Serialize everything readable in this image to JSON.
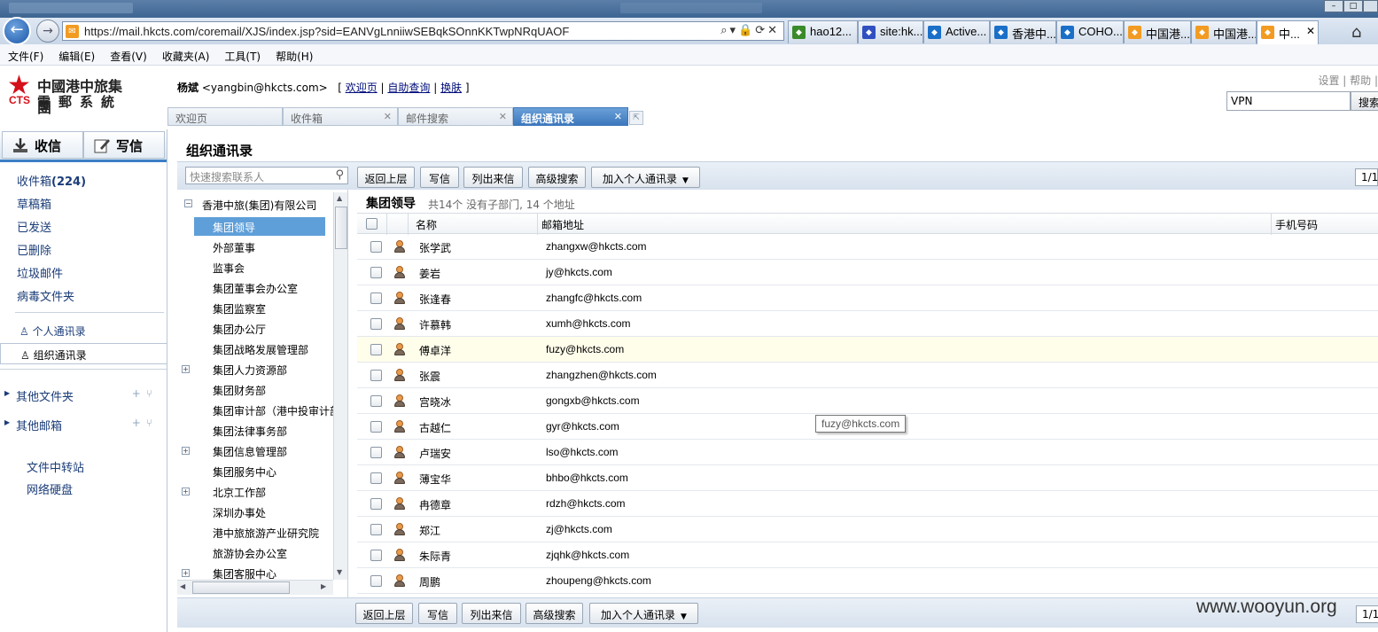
{
  "browser": {
    "url": "https://mail.hkcts.com/coremail/XJS/index.jsp?sid=EANVgLnniiwSEBqkSOnnKKTwpNRqUAOF",
    "tabs": [
      {
        "label": "hao12...",
        "color": "#3a8a2a"
      },
      {
        "label": "site:hk...",
        "color": "#3050c0"
      },
      {
        "label": "Active...",
        "color": "#1a6fc8"
      },
      {
        "label": "香港中...",
        "color": "#1a6fc8"
      },
      {
        "label": "COHO...",
        "color": "#1a6fc8"
      },
      {
        "label": "中国港...",
        "color": "#f29b22"
      },
      {
        "label": "中国港...",
        "color": "#f29b22"
      },
      {
        "label": "中...",
        "color": "#f29b22"
      }
    ],
    "menu": [
      "文件(F)",
      "编辑(E)",
      "查看(V)",
      "收藏夹(A)",
      "工具(T)",
      "帮助(H)"
    ]
  },
  "logo": {
    "line1": "中國港中旅集團",
    "line2": "電郵系統",
    "mark": "CTS"
  },
  "user": {
    "name": "杨斌",
    "email": "<yangbin@hkcts.com>",
    "links": [
      "欢迎页",
      "自助查询",
      "换肤"
    ]
  },
  "toplinks": "设置 | 帮助 |",
  "search": {
    "value": "VPN",
    "button": "搜索"
  },
  "mailtabs": [
    "欢迎页",
    "收件箱",
    "邮件搜索",
    "组织通讯录"
  ],
  "sidebar": {
    "receive": "收信",
    "compose": "写信",
    "inbox_label": "收件箱",
    "inbox_count": "(224)",
    "folders": [
      "草稿箱",
      "已发送",
      "已删除",
      "垃圾邮件",
      "病毒文件夹"
    ],
    "personal_contacts": "个人通讯录",
    "org_contacts": "组织通讯录",
    "other_folders": "其他文件夹",
    "other_mailboxes": "其他邮箱",
    "tools": [
      "文件中转站",
      "网络硬盘"
    ]
  },
  "page": {
    "title": "组织通讯录",
    "search_placeholder": "快速搜索联系人",
    "toolbar": [
      "返回上层",
      "写信",
      "列出来信",
      "高级搜索",
      "加入个人通讯录"
    ],
    "pager": "1/1",
    "pager_bottom": "1/1"
  },
  "tree": {
    "root": "香港中旅(集团)有限公司",
    "items": [
      {
        "label": "集团领导",
        "expandable": false,
        "selected": true
      },
      {
        "label": "外部董事",
        "expandable": false
      },
      {
        "label": "监事会",
        "expandable": false
      },
      {
        "label": "集团董事会办公室",
        "expandable": false
      },
      {
        "label": "集团监察室",
        "expandable": false
      },
      {
        "label": "集团办公厅",
        "expandable": false
      },
      {
        "label": "集团战略发展管理部",
        "expandable": false
      },
      {
        "label": "集团人力资源部",
        "expandable": true
      },
      {
        "label": "集团财务部",
        "expandable": false
      },
      {
        "label": "集团审计部（港中投审计部）",
        "expandable": false
      },
      {
        "label": "集团法律事务部",
        "expandable": false
      },
      {
        "label": "集团信息管理部",
        "expandable": true
      },
      {
        "label": "集团服务中心",
        "expandable": false
      },
      {
        "label": "北京工作部",
        "expandable": true
      },
      {
        "label": "深圳办事处",
        "expandable": false
      },
      {
        "label": "港中旅旅游产业研究院",
        "expandable": false
      },
      {
        "label": "旅游协会办公室",
        "expandable": false
      },
      {
        "label": "集团客服中心",
        "expandable": true
      }
    ]
  },
  "group": {
    "name": "集团领导",
    "info": "共14个 没有子部门, 14 个地址"
  },
  "columns": {
    "name": "名称",
    "email": "邮箱地址",
    "mobile": "手机号码"
  },
  "contacts": [
    {
      "name": "张学武",
      "email": "zhangxw@hkcts.com"
    },
    {
      "name": "姜岩",
      "email": "jy@hkcts.com"
    },
    {
      "name": "张逢春",
      "email": "zhangfc@hkcts.com"
    },
    {
      "name": "许慕韩",
      "email": "xumh@hkcts.com"
    },
    {
      "name": "傅卓洋",
      "email": "fuzy@hkcts.com"
    },
    {
      "name": "张震",
      "email": "zhangzhen@hkcts.com"
    },
    {
      "name": "宫晓冰",
      "email": "gongxb@hkcts.com"
    },
    {
      "name": "古越仁",
      "email": "gyr@hkcts.com"
    },
    {
      "name": "卢瑞安",
      "email": "lso@hkcts.com"
    },
    {
      "name": "薄宝华",
      "email": "bhbo@hkcts.com"
    },
    {
      "name": "冉德章",
      "email": "rdzh@hkcts.com"
    },
    {
      "name": "郑江",
      "email": "zj@hkcts.com"
    },
    {
      "name": "朱际青",
      "email": "zjqhk@hkcts.com"
    },
    {
      "name": "周鹏",
      "email": "zhoupeng@hkcts.com"
    }
  ],
  "tooltip": "fuzy@hkcts.com",
  "watermark": "www.wooyun.org"
}
